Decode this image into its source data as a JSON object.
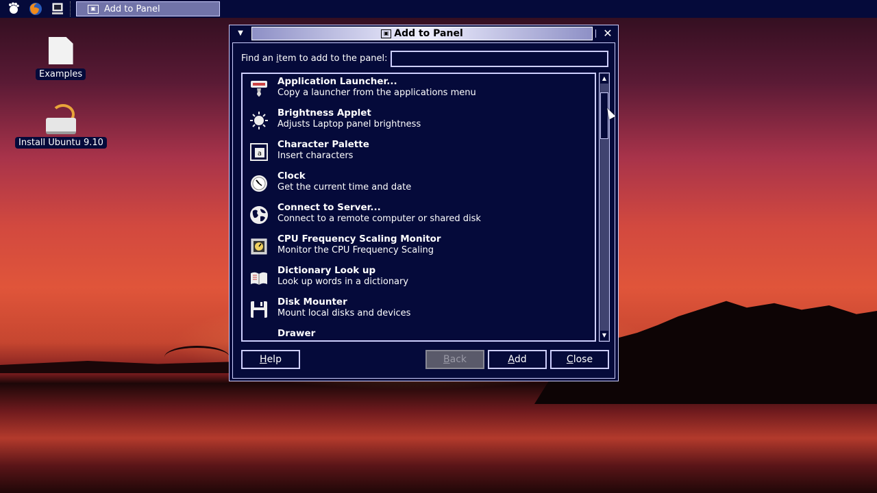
{
  "top_panel": {
    "icons": [
      "gnome-foot-icon",
      "firefox-icon",
      "computer-icon"
    ],
    "taskbar_item": "Add to Panel"
  },
  "desktop": {
    "icons": [
      {
        "label": "Examples",
        "icon": "document-icon"
      },
      {
        "label": "Install Ubuntu 9.10",
        "icon": "installer-icon"
      }
    ]
  },
  "dialog": {
    "title": "Add to Panel",
    "find_label_pre": "Find an ",
    "find_label_u": "i",
    "find_label_post": "tem to add to the panel:",
    "search_value": "",
    "items": [
      {
        "name": "Application Launcher...",
        "desc": "Copy a launcher from the applications menu",
        "icon": "launcher-icon"
      },
      {
        "name": "Brightness Applet",
        "desc": "Adjusts Laptop panel brightness",
        "icon": "brightness-icon"
      },
      {
        "name": "Character Palette",
        "desc": "Insert characters",
        "icon": "character-palette-icon"
      },
      {
        "name": "Clock",
        "desc": "Get the current time and date",
        "icon": "clock-icon"
      },
      {
        "name": "Connect to Server...",
        "desc": "Connect to a remote computer or shared disk",
        "icon": "globe-icon"
      },
      {
        "name": "CPU Frequency Scaling Monitor",
        "desc": "Monitor the CPU Frequency Scaling",
        "icon": "cpu-icon"
      },
      {
        "name": "Dictionary Look up",
        "desc": "Look up words in a dictionary",
        "icon": "dictionary-icon"
      },
      {
        "name": "Disk Mounter",
        "desc": "Mount local disks and devices",
        "icon": "floppy-icon"
      },
      {
        "name": "Drawer",
        "desc": "",
        "icon": "drawer-icon"
      }
    ],
    "buttons": {
      "help_u": "H",
      "help_rest": "elp",
      "back_u": "B",
      "back_rest": "ack",
      "add_u": "A",
      "add_rest": "dd",
      "close_u": "C",
      "close_rest": "lose"
    },
    "colors": {
      "background": "#050a3a",
      "border": "#cfd0ff"
    }
  }
}
